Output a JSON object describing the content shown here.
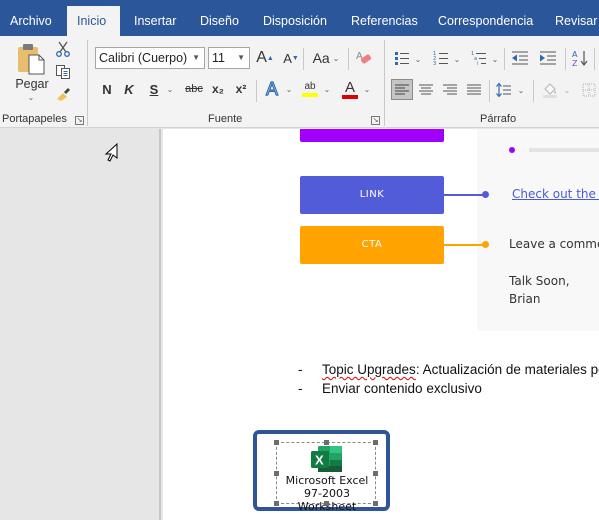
{
  "tabs": [
    {
      "label": "Archivo",
      "active": false
    },
    {
      "label": "Inicio",
      "active": true
    },
    {
      "label": "Insertar",
      "active": false
    },
    {
      "label": "Diseño",
      "active": false
    },
    {
      "label": "Disposición",
      "active": false
    },
    {
      "label": "Referencias",
      "active": false
    },
    {
      "label": "Correspondencia",
      "active": false
    },
    {
      "label": "Revisar",
      "active": false
    }
  ],
  "ribbon": {
    "clipboard": {
      "label": "Portapapeles",
      "paste_label": "Pegar",
      "icons": [
        "paste-icon",
        "cut-icon",
        "copy-icon",
        "format-painter-icon"
      ]
    },
    "font": {
      "label": "Fuente",
      "font_name": "Calibri (Cuerpo)",
      "font_size": "11",
      "grow_glyph": "A",
      "shrink_glyph": "A",
      "case_glyph": "Aa",
      "bold": "N",
      "italic": "K",
      "underline": "S",
      "strikethrough": "abc",
      "subscript": "x₂",
      "superscript": "x²",
      "effects_glyph": "A",
      "highlight_glyph": "ab",
      "font_color_glyph": "A",
      "highlight_color": "#ffff00",
      "font_color": "#e00000"
    },
    "paragraph": {
      "label": "Párrafo",
      "align_active": "left"
    }
  },
  "document": {
    "email_diagram": {
      "bars": [
        {
          "label": "",
          "color": "#a100ff"
        },
        {
          "label": "LINK",
          "color": "#535cd8"
        },
        {
          "label": "CTA",
          "color": "#ffa300"
        }
      ],
      "link_text": "Check out the n",
      "cta_text": "Leave a comme",
      "signoff": "Talk Soon,",
      "signature": "Brian",
      "link_color": "#4a5ad6",
      "dot_purple": "#a100ff",
      "dot_blue": "#535cd8",
      "dot_orange": "#ffa300"
    },
    "bullets": [
      {
        "dash": "-",
        "prefix": "Topic Upgrades",
        "text": ": Actualización de materiales po"
      },
      {
        "dash": "-",
        "prefix": "",
        "text": "Enviar contenido exclusivo"
      }
    ],
    "embedded_object": {
      "icon": "excel-icon",
      "caption_line1": "Microsoft Excel",
      "caption_line2": "97-2003 Worksheet"
    }
  }
}
